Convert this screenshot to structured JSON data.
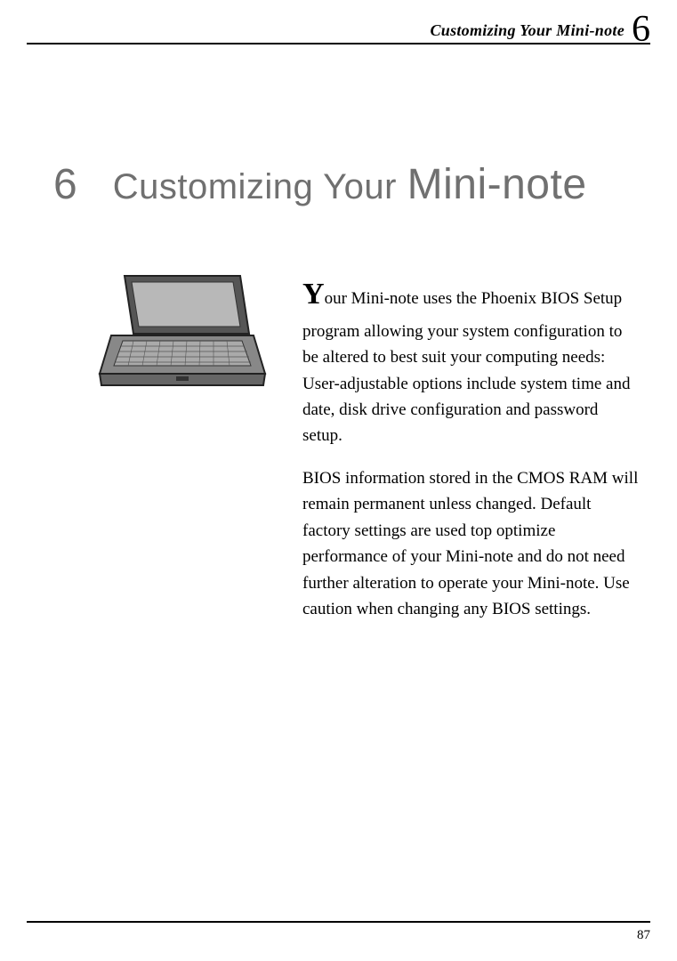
{
  "header": {
    "title": "Customizing Your Mini-note",
    "chapter_header_num": "6"
  },
  "heading": {
    "chapter_num": "6",
    "title_prefix": "Customizing Your ",
    "title_emph": "Mini-note"
  },
  "body": {
    "p1_dropcap": "Y",
    "p1_rest": "our Mini-note uses the Phoenix BIOS Setup program allowing your system configuration to be altered to best suit your computing needs: User-adjustable options include system time and date, disk drive configuration and password setup.",
    "p2": "BIOS information stored in the CMOS RAM will remain permanent unless changed. Default factory settings are used top optimize performance of your Mini-note and do not need further alteration to operate your Mini-note. Use caution when changing any BIOS settings."
  },
  "footer": {
    "page_number": "87"
  }
}
